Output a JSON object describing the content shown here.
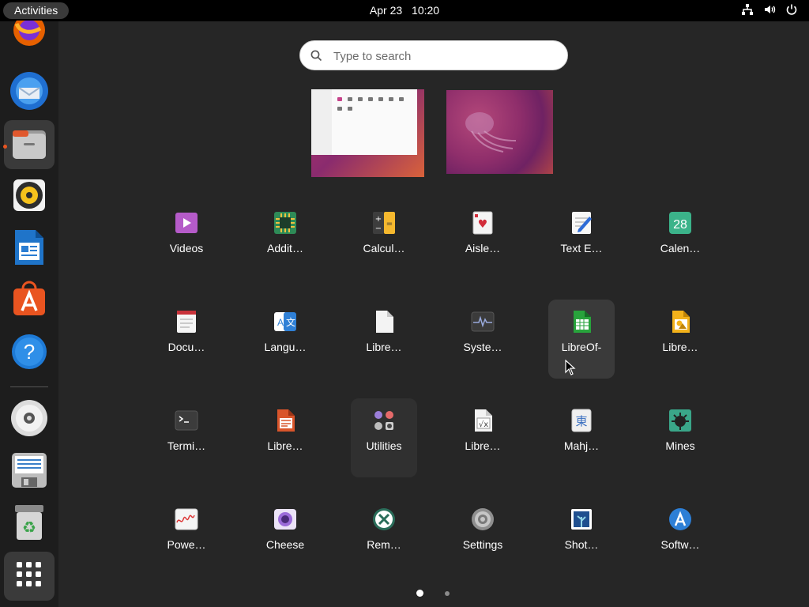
{
  "topbar": {
    "activities_label": "Activities",
    "date": "Apr 23",
    "time": "10:20",
    "tray_icons": [
      "network-icon",
      "volume-icon",
      "power-icon"
    ]
  },
  "dock": {
    "items": [
      {
        "name": "firefox",
        "icon": "firefox-icon"
      },
      {
        "name": "thunderbird",
        "icon": "thunderbird-icon"
      },
      {
        "name": "files",
        "icon": "files-icon",
        "active": true,
        "running": true
      },
      {
        "name": "rhythmbox",
        "icon": "rhythmbox-icon"
      },
      {
        "name": "libreoffice-writer",
        "icon": "writer-icon"
      },
      {
        "name": "ubuntu-software",
        "icon": "software-icon"
      },
      {
        "name": "help",
        "icon": "help-icon"
      },
      {
        "name": "disc",
        "icon": "disc-icon"
      },
      {
        "name": "save-drive",
        "icon": "drive-icon"
      },
      {
        "name": "trash",
        "icon": "trash-icon"
      },
      {
        "name": "show-apps",
        "icon": "grid-icon"
      }
    ]
  },
  "search": {
    "placeholder": "Type to search",
    "value": ""
  },
  "apps": [
    {
      "label": "Videos",
      "icon": "videos-icon"
    },
    {
      "label": "Addit…",
      "icon": "additional-drivers-icon"
    },
    {
      "label": "Calcul…",
      "icon": "calculator-icon"
    },
    {
      "label": "Aisle…",
      "icon": "aisleriot-icon"
    },
    {
      "label": "Text E…",
      "icon": "text-editor-icon"
    },
    {
      "label": "Calen…",
      "icon": "calendar-icon",
      "calendar_day": "28"
    },
    {
      "label": "Docu…",
      "icon": "document-viewer-icon"
    },
    {
      "label": "Langu…",
      "icon": "language-icon"
    },
    {
      "label": "Libre…",
      "icon": "libreoffice-icon"
    },
    {
      "label": "Syste…",
      "icon": "system-monitor-icon"
    },
    {
      "label": "LibreOf-",
      "icon": "libreoffice-calc-icon"
    },
    {
      "label": "Libre…",
      "icon": "libreoffice-draw-icon"
    },
    {
      "label": "Termi…",
      "icon": "terminal-icon"
    },
    {
      "label": "Libre…",
      "icon": "libreoffice-impress-icon"
    },
    {
      "label": "Utilities",
      "icon": "utilities-folder-icon"
    },
    {
      "label": "Libre…",
      "icon": "libreoffice-math-icon"
    },
    {
      "label": "Mahj…",
      "icon": "mahjongg-icon",
      "glyph": "東"
    },
    {
      "label": "Mines",
      "icon": "mines-icon"
    },
    {
      "label": "Powe…",
      "icon": "power-statistics-icon"
    },
    {
      "label": "Cheese",
      "icon": "cheese-icon"
    },
    {
      "label": "Rem…",
      "icon": "remmina-icon"
    },
    {
      "label": "Settings",
      "icon": "settings-icon"
    },
    {
      "label": "Shot…",
      "icon": "shotwell-icon"
    },
    {
      "label": "Softw…",
      "icon": "software-updater-icon"
    }
  ],
  "pagination": {
    "current_page": 1,
    "total_pages": 2
  },
  "colors": {
    "accent": "#e95420",
    "background": "#262626",
    "dock": "#1d1d1d"
  }
}
